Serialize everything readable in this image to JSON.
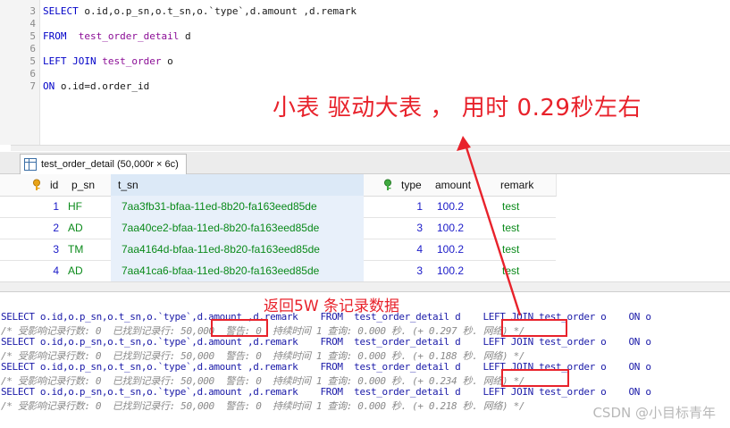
{
  "editor": {
    "lines": [
      {
        "n": "3",
        "parts": [
          [
            "kw",
            "SELECT"
          ],
          [
            "t",
            " o.id,o.p_sn,o.t_sn,o.`type`,d.amount ,d.remark"
          ]
        ]
      },
      {
        "n": "4",
        "parts": [
          [
            "t",
            ""
          ]
        ]
      },
      {
        "n": "5",
        "parts": [
          [
            "kw",
            "FROM"
          ],
          [
            "t",
            "  "
          ],
          [
            "tbl",
            "test_order_detail"
          ],
          [
            "t",
            " d"
          ]
        ]
      },
      {
        "n": "6",
        "parts": [
          [
            "t",
            ""
          ]
        ]
      },
      {
        "n": "5",
        "parts": [
          [
            "kw",
            "LEFT JOIN"
          ],
          [
            "t",
            " "
          ],
          [
            "tbl",
            "test_order"
          ],
          [
            "t",
            " o"
          ]
        ]
      },
      {
        "n": "6",
        "parts": [
          [
            "t",
            ""
          ]
        ]
      },
      {
        "n": "7",
        "parts": [
          [
            "kw",
            "ON"
          ],
          [
            "t",
            " o.id=d.order_id"
          ]
        ]
      }
    ],
    "annotation": "小表 驱动大表 ， 用时 0.29秒左右"
  },
  "result_tab": {
    "label": "test_order_detail (50,000r × 6c)"
  },
  "grid": {
    "columns": [
      "id",
      "p_sn",
      "t_sn",
      "type",
      "amount",
      "remark"
    ],
    "rows": [
      [
        "1",
        "HF",
        "7aa3fb31-bfaa-11ed-8b20-fa163eed85de",
        "1",
        "100.2",
        "test"
      ],
      [
        "2",
        "AD",
        "7aa40ce2-bfaa-11ed-8b20-fa163eed85de",
        "3",
        "100.2",
        "test"
      ],
      [
        "3",
        "TM",
        "7aa4164d-bfaa-11ed-8b20-fa163eed85de",
        "4",
        "100.2",
        "test"
      ],
      [
        "4",
        "AD",
        "7aa41ca6-bfaa-11ed-8b20-fa163eed85de",
        "3",
        "100.2",
        "test"
      ]
    ]
  },
  "messages": {
    "note": "返回5W 条记录数据",
    "entries": [
      {
        "sql": "SELECT o.id,o.p_sn,o.t_sn,o.`type`,d.amount ,d.remark    FROM  test_order_detail d    LEFT JOIN test_order o    ON o",
        "info": "/* 受影响记录行数: 0  已找到记录行: 50,000  警告: 0  持续时间 1 查询: 0.000 秒. (+ 0.297 秒. 网络) */"
      },
      {
        "sql": "SELECT o.id,o.p_sn,o.t_sn,o.`type`,d.amount ,d.remark    FROM  test_order_detail d    LEFT JOIN test_order o    ON o",
        "info": "/* 受影响记录行数: 0  已找到记录行: 50,000  警告: 0  持续时间 1 查询: 0.000 秒. (+ 0.188 秒. 网络) */"
      },
      {
        "sql": "SELECT o.id,o.p_sn,o.t_sn,o.`type`,d.amount ,d.remark    FROM  test_order_detail d    LEFT JOIN test_order o    ON o",
        "info": "/* 受影响记录行数: 0  已找到记录行: 50,000  警告: 0  持续时间 1 查询: 0.000 秒. (+ 0.234 秒. 网络) */"
      },
      {
        "sql": "SELECT o.id,o.p_sn,o.t_sn,o.`type`,d.amount ,d.remark    FROM  test_order_detail d    LEFT JOIN test_order o    ON o",
        "info": "/* 受影响记录行数: 0  已找到记录行: 50,000  警告: 0  持续时间 1 查询: 0.000 秒. (+ 0.218 秒. 网络) */"
      }
    ],
    "watermark": "CSDN @小目标青年"
  },
  "colors": {
    "accent_red": "#e8222b",
    "keyword_blue": "#0000c8",
    "number_blue": "#1a1ac8",
    "string_green": "#0a8a1a"
  }
}
